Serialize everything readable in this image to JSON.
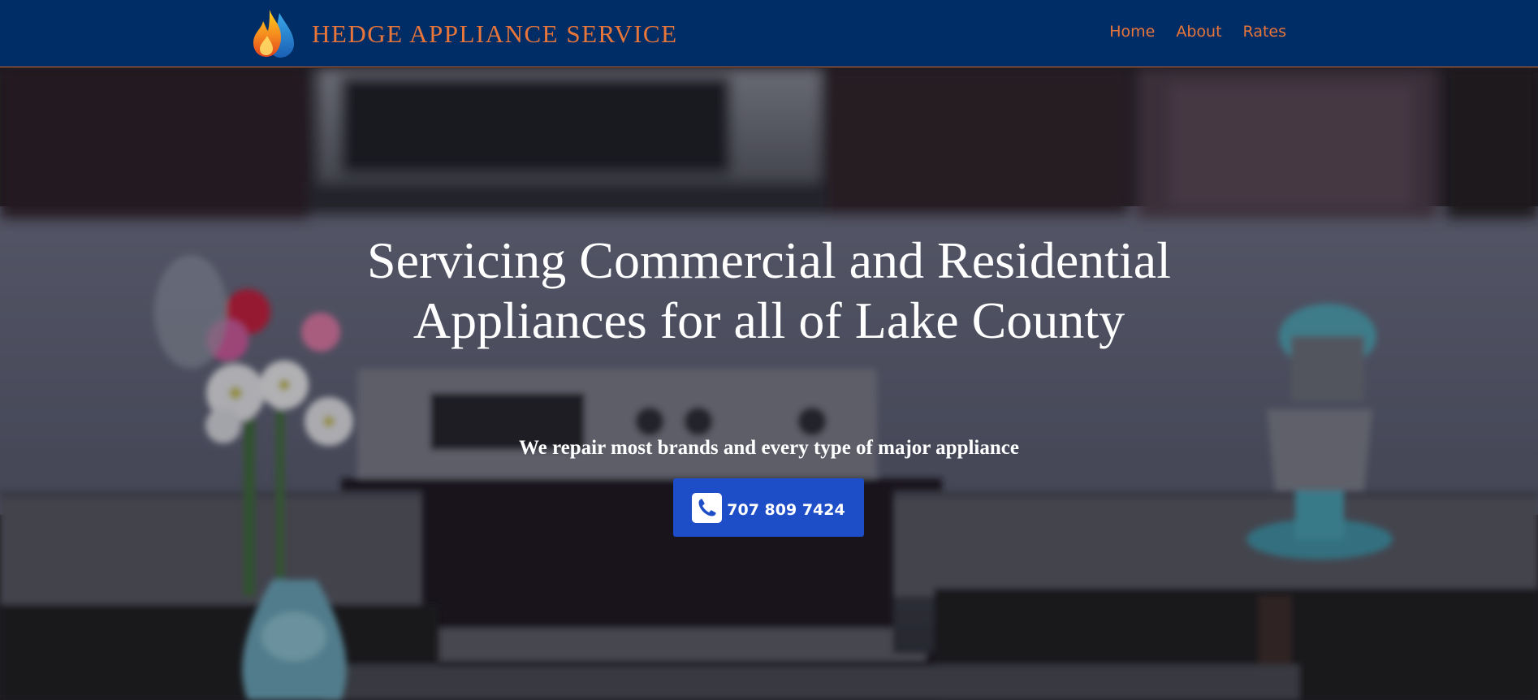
{
  "brand": {
    "name": "HEDGE APPLIANCE SERVICE",
    "logo_icon": "flame-logo-icon",
    "color": "#e8753a"
  },
  "nav": {
    "background": "#002d66",
    "links": [
      {
        "label": "Home"
      },
      {
        "label": "About"
      },
      {
        "label": "Rates"
      }
    ]
  },
  "hero": {
    "background_description_icon": "kitchen-background-photo",
    "title": "Servicing Commercial and Residential Appliances for all of Lake County",
    "subtitle": "We repair most brands and every type of major appliance",
    "call_button": {
      "label": "707 809 7424",
      "icon": "phone-square-icon",
      "color": "#1e4dc8"
    }
  }
}
